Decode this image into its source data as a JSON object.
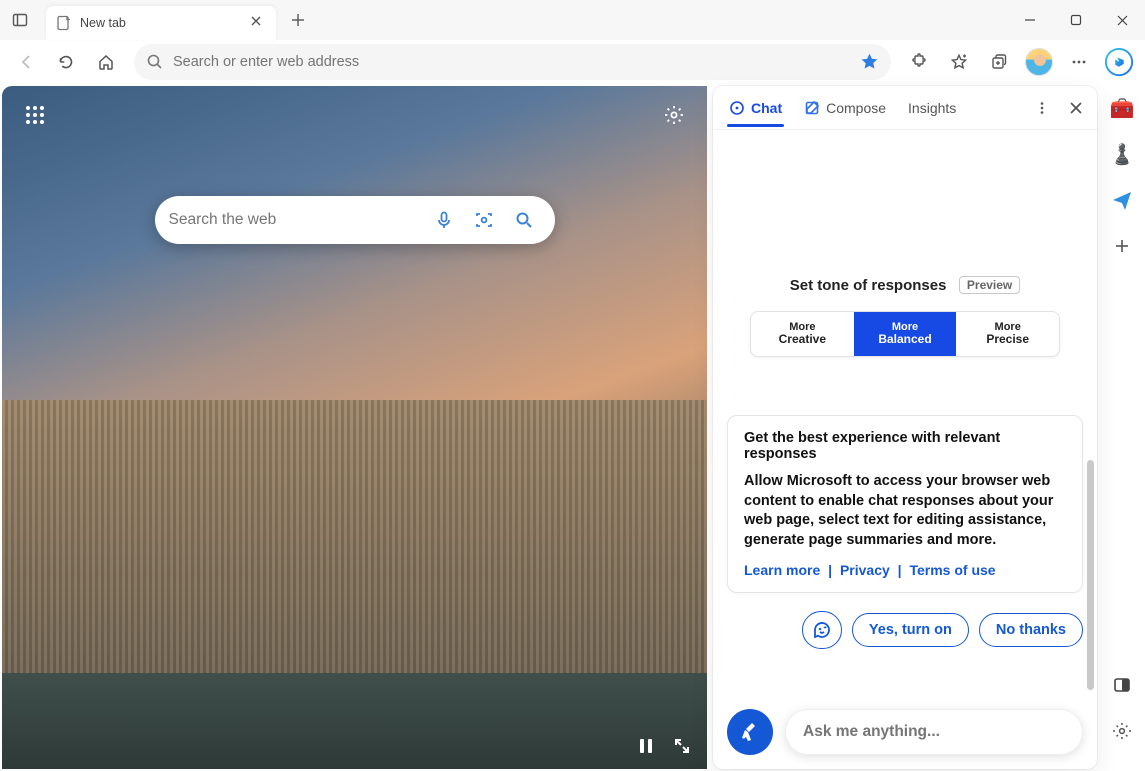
{
  "titlebar": {
    "tab_title": "New tab"
  },
  "toolbar": {
    "address_placeholder": "Search or enter web address"
  },
  "ntp": {
    "search_placeholder": "Search the web"
  },
  "panel": {
    "tabs": {
      "chat": "Chat",
      "compose": "Compose",
      "insights": "Insights"
    },
    "tone": {
      "label": "Set tone of responses",
      "preview": "Preview",
      "more": "More",
      "creative": "Creative",
      "balanced": "Balanced",
      "precise": "Precise"
    },
    "card": {
      "title": "Get the best experience with relevant responses",
      "body": "Allow Microsoft to access your browser web content to enable chat responses about your web page, select text for editing assistance, generate page summaries and more.",
      "learn": "Learn more",
      "privacy": "Privacy",
      "terms": "Terms of use",
      "sep": "|"
    },
    "cta": {
      "yes": "Yes, turn on",
      "no": "No thanks"
    },
    "ask_placeholder": "Ask me anything..."
  }
}
